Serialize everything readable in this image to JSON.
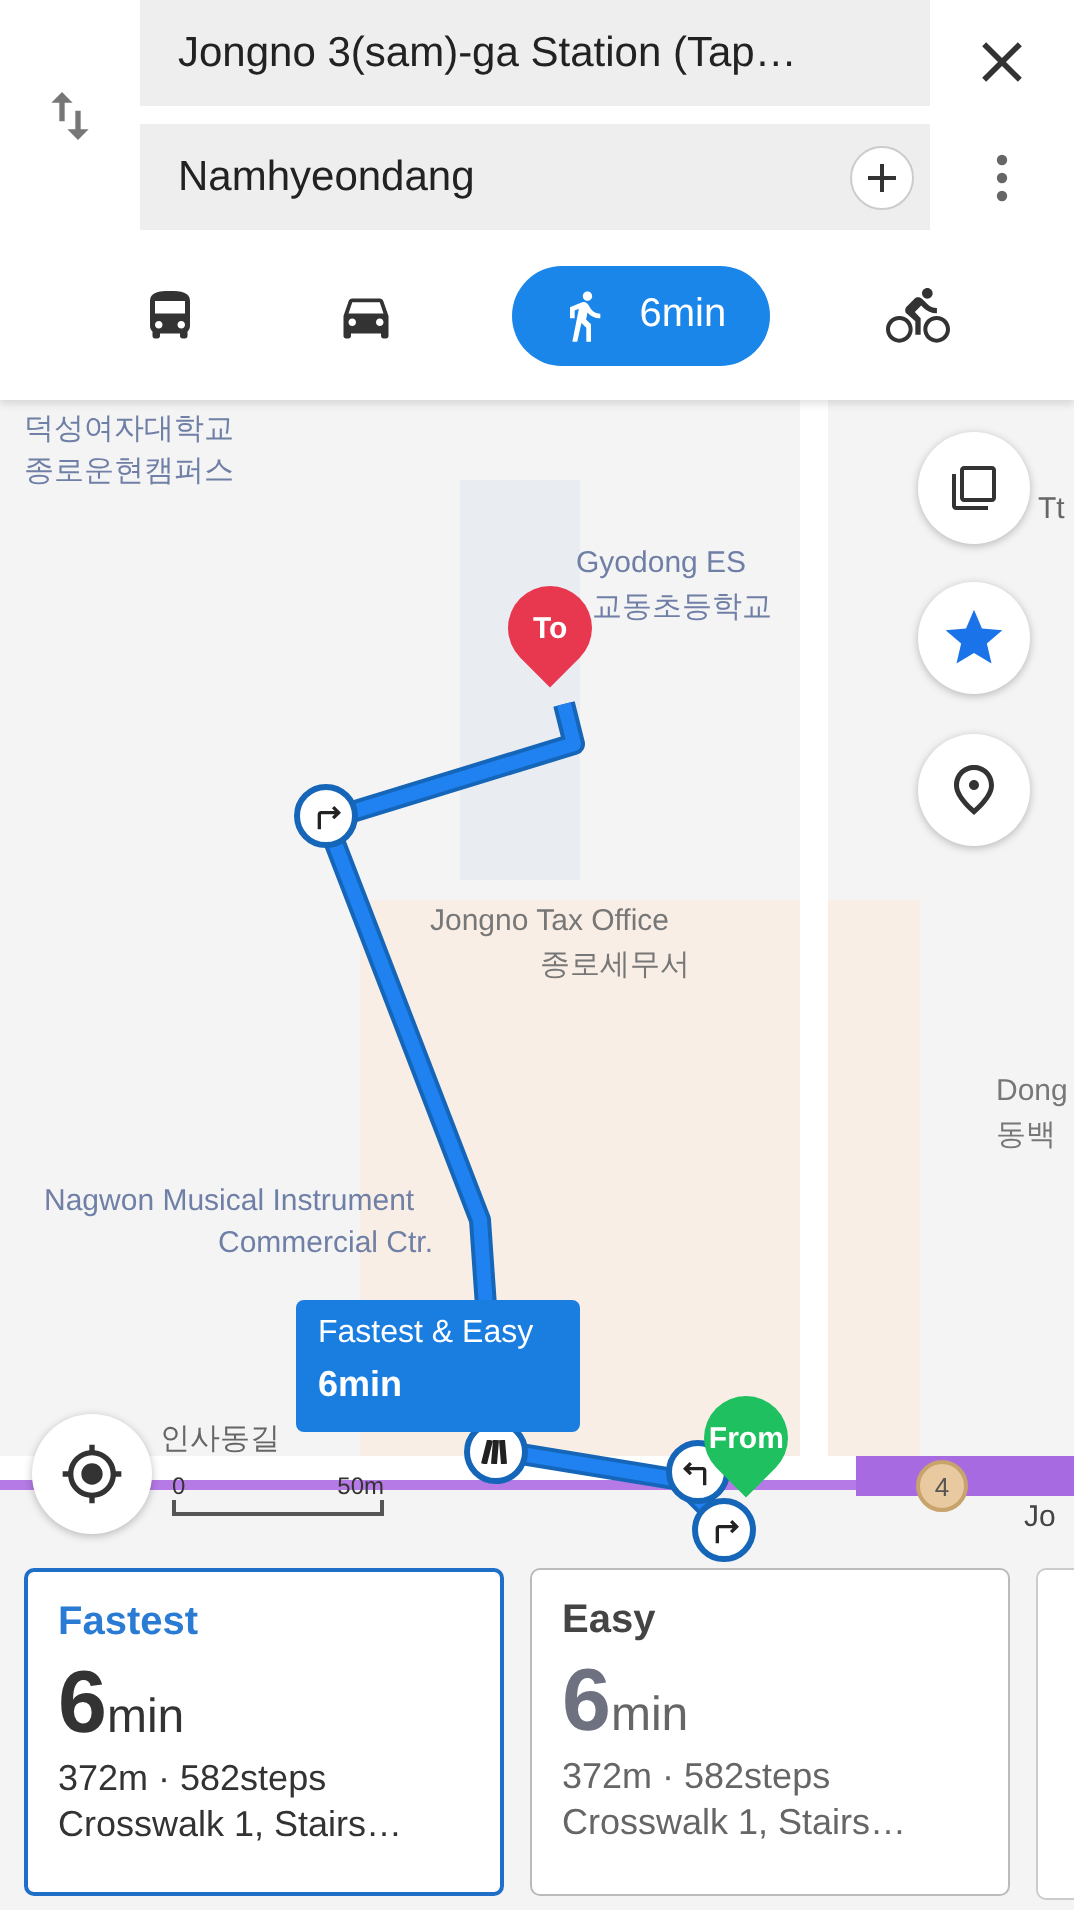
{
  "route_inputs": {
    "origin": "Jongno 3(sam)-ga Station (Tap…",
    "destination": "Namhyeondang"
  },
  "modes": [
    {
      "kind": "bus",
      "selected": false
    },
    {
      "kind": "car",
      "selected": false
    },
    {
      "kind": "walk",
      "selected": true,
      "label": "6min"
    },
    {
      "kind": "bike",
      "selected": false
    }
  ],
  "map": {
    "labels": [
      "덕성여자대학교",
      "종로운현캠퍼스",
      "Gyodong ES",
      "교동초등학교",
      "Tt",
      "Jongno Tax Office",
      "종로세무서",
      "Dong",
      "동백",
      "Nagwon Musical Instrument",
      "Commercial Ctr.",
      "인사동길",
      "Jo"
    ],
    "to_pin": "To",
    "from_pin": "From",
    "subway_badge": "4",
    "route_bubble": {
      "title": "Fastest & Easy",
      "time": "6min"
    },
    "scale": {
      "start": "0",
      "end": "50m"
    }
  },
  "route_cards": [
    {
      "title": "Fastest",
      "number": "6",
      "unit": "min",
      "summary": "372m · 582steps",
      "features": "Crosswalk 1, Stairs…",
      "selected": true
    },
    {
      "title": "Easy",
      "number": "6",
      "unit": "min",
      "summary": "372m · 582steps",
      "features": "Crosswalk 1, Stairs…",
      "selected": false
    }
  ]
}
